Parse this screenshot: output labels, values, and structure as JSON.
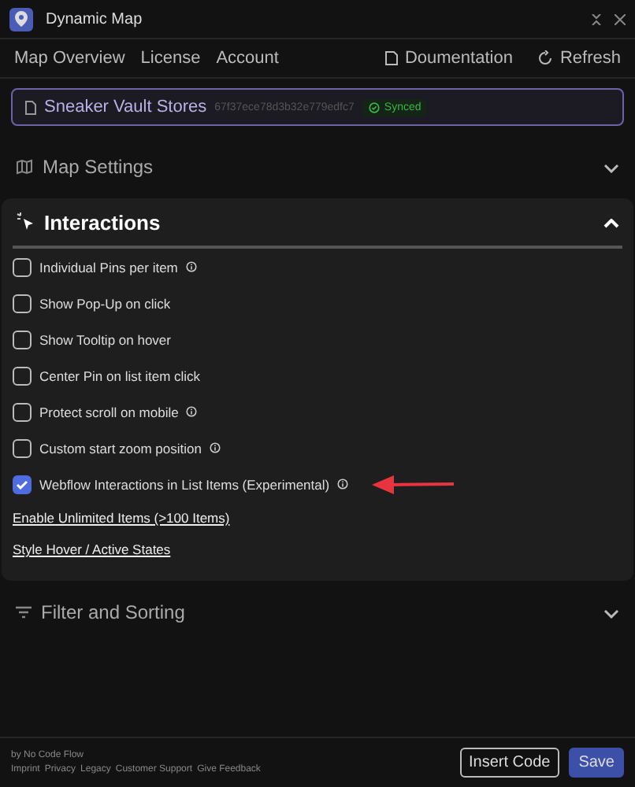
{
  "window": {
    "title": "Dynamic Map"
  },
  "nav": {
    "tabs": [
      {
        "label": "Map Overview"
      },
      {
        "label": "License"
      },
      {
        "label": "Account"
      }
    ],
    "actions": [
      {
        "label": "Doumentation",
        "kind": "docs"
      },
      {
        "label": "Refresh",
        "kind": "refresh"
      }
    ]
  },
  "collection": {
    "name": "Sneaker Vault Stores",
    "id": "67f37ece78d3b32e779edfc7",
    "status": "Synced"
  },
  "sections": [
    {
      "title": "Map Settings",
      "kind": "map",
      "expanded": false
    },
    {
      "title": "Interactions",
      "kind": "interactions",
      "expanded": true,
      "items": [
        {
          "kind": "checkbox",
          "label": "Individual Pins per item",
          "checked": false,
          "info": true,
          "highlighted": false
        },
        {
          "kind": "checkbox",
          "label": "Show Pop-Up on click",
          "checked": false,
          "info": false,
          "highlighted": false
        },
        {
          "kind": "checkbox",
          "label": "Show Tooltip on hover",
          "checked": false,
          "info": false,
          "highlighted": false
        },
        {
          "kind": "checkbox",
          "label": "Center Pin on list item click",
          "checked": false,
          "info": false,
          "highlighted": false
        },
        {
          "kind": "checkbox",
          "label": "Protect scroll on mobile",
          "checked": false,
          "info": true,
          "highlighted": false
        },
        {
          "kind": "checkbox",
          "label": "Custom start zoom position",
          "checked": false,
          "info": true,
          "highlighted": false
        },
        {
          "kind": "checkbox",
          "label": "Webflow Interactions in List Items (Experimental)",
          "checked": true,
          "info": true,
          "highlighted": true
        },
        {
          "kind": "link",
          "label": "Enable Unlimited Items (>100 Items)"
        },
        {
          "kind": "link",
          "label": "Style Hover / Active States"
        }
      ]
    },
    {
      "title": "Filter and Sorting",
      "kind": "filter",
      "expanded": false
    }
  ],
  "footer": {
    "credit": "by No Code Flow",
    "links": [
      "Imprint",
      "Privacy",
      "Legacy",
      "Customer Support",
      "Give Feedback"
    ],
    "buttons": [
      {
        "label": "Insert Code",
        "kind": "secondary"
      },
      {
        "label": "Save",
        "kind": "primary"
      }
    ]
  }
}
